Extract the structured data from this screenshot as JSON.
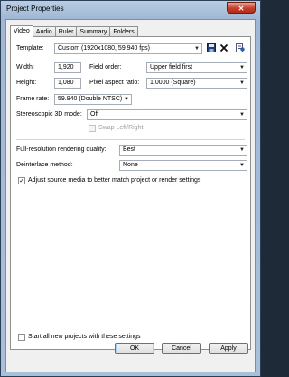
{
  "window": {
    "title": "Project Properties",
    "close_glyph": "✕"
  },
  "tabs": [
    {
      "label": "Video",
      "active": true
    },
    {
      "label": "Audio"
    },
    {
      "label": "Ruler"
    },
    {
      "label": "Summary"
    },
    {
      "label": "Folders"
    }
  ],
  "video": {
    "template_label": "Template:",
    "template_value": "Custom (1920x1080, 59.940 fps)",
    "width_label": "Width:",
    "width_value": "1,920",
    "field_order_label": "Field order:",
    "field_order_value": "Upper field first",
    "height_label": "Height:",
    "height_value": "1,080",
    "pixel_aspect_label": "Pixel aspect ratio:",
    "pixel_aspect_value": "1.0000 (Square)",
    "frame_rate_label": "Frame rate:",
    "frame_rate_value": "59.940 (Double NTSC)",
    "stereo_label": "Stereoscopic 3D mode:",
    "stereo_value": "Off",
    "swap_label": "Swap Left/Right",
    "quality_label": "Full-resolution rendering quality:",
    "quality_value": "Best",
    "deinterlace_label": "Deinterlace method:",
    "deinterlace_value": "None",
    "adjust_label": "Adjust source media to better match project or render settings",
    "adjust_checked": true,
    "start_all_label": "Start all new projects with these settings",
    "start_all_checked": false
  },
  "buttons": {
    "ok": "OK",
    "cancel": "Cancel",
    "apply": "Apply"
  },
  "icons": {
    "save": "save-icon",
    "delete": "delete-icon",
    "properties": "properties-icon"
  }
}
